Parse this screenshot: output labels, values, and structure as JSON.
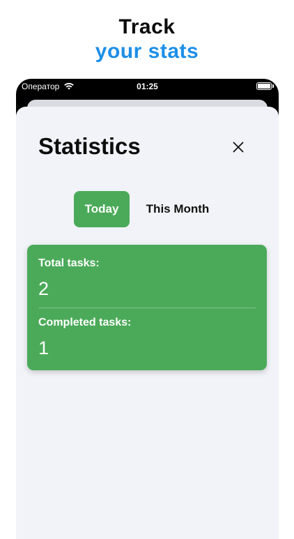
{
  "promo": {
    "line1": "Track",
    "line2": "your stats",
    "accent_color": "#1d8fe8"
  },
  "status_bar": {
    "carrier": "Оператор",
    "time": "01:25",
    "icons": [
      "wifi-icon",
      "battery-icon"
    ]
  },
  "screen": {
    "title": "Statistics",
    "close_icon": "close-icon",
    "segments": [
      {
        "label": "Today",
        "selected": true
      },
      {
        "label": "This Month",
        "selected": false
      }
    ],
    "stats": {
      "total_label": "Total tasks:",
      "total_value": "2",
      "completed_label": "Completed tasks:",
      "completed_value": "1"
    },
    "colors": {
      "accent_green": "#4baa59",
      "sheet_background": "#f1f3f8"
    }
  }
}
